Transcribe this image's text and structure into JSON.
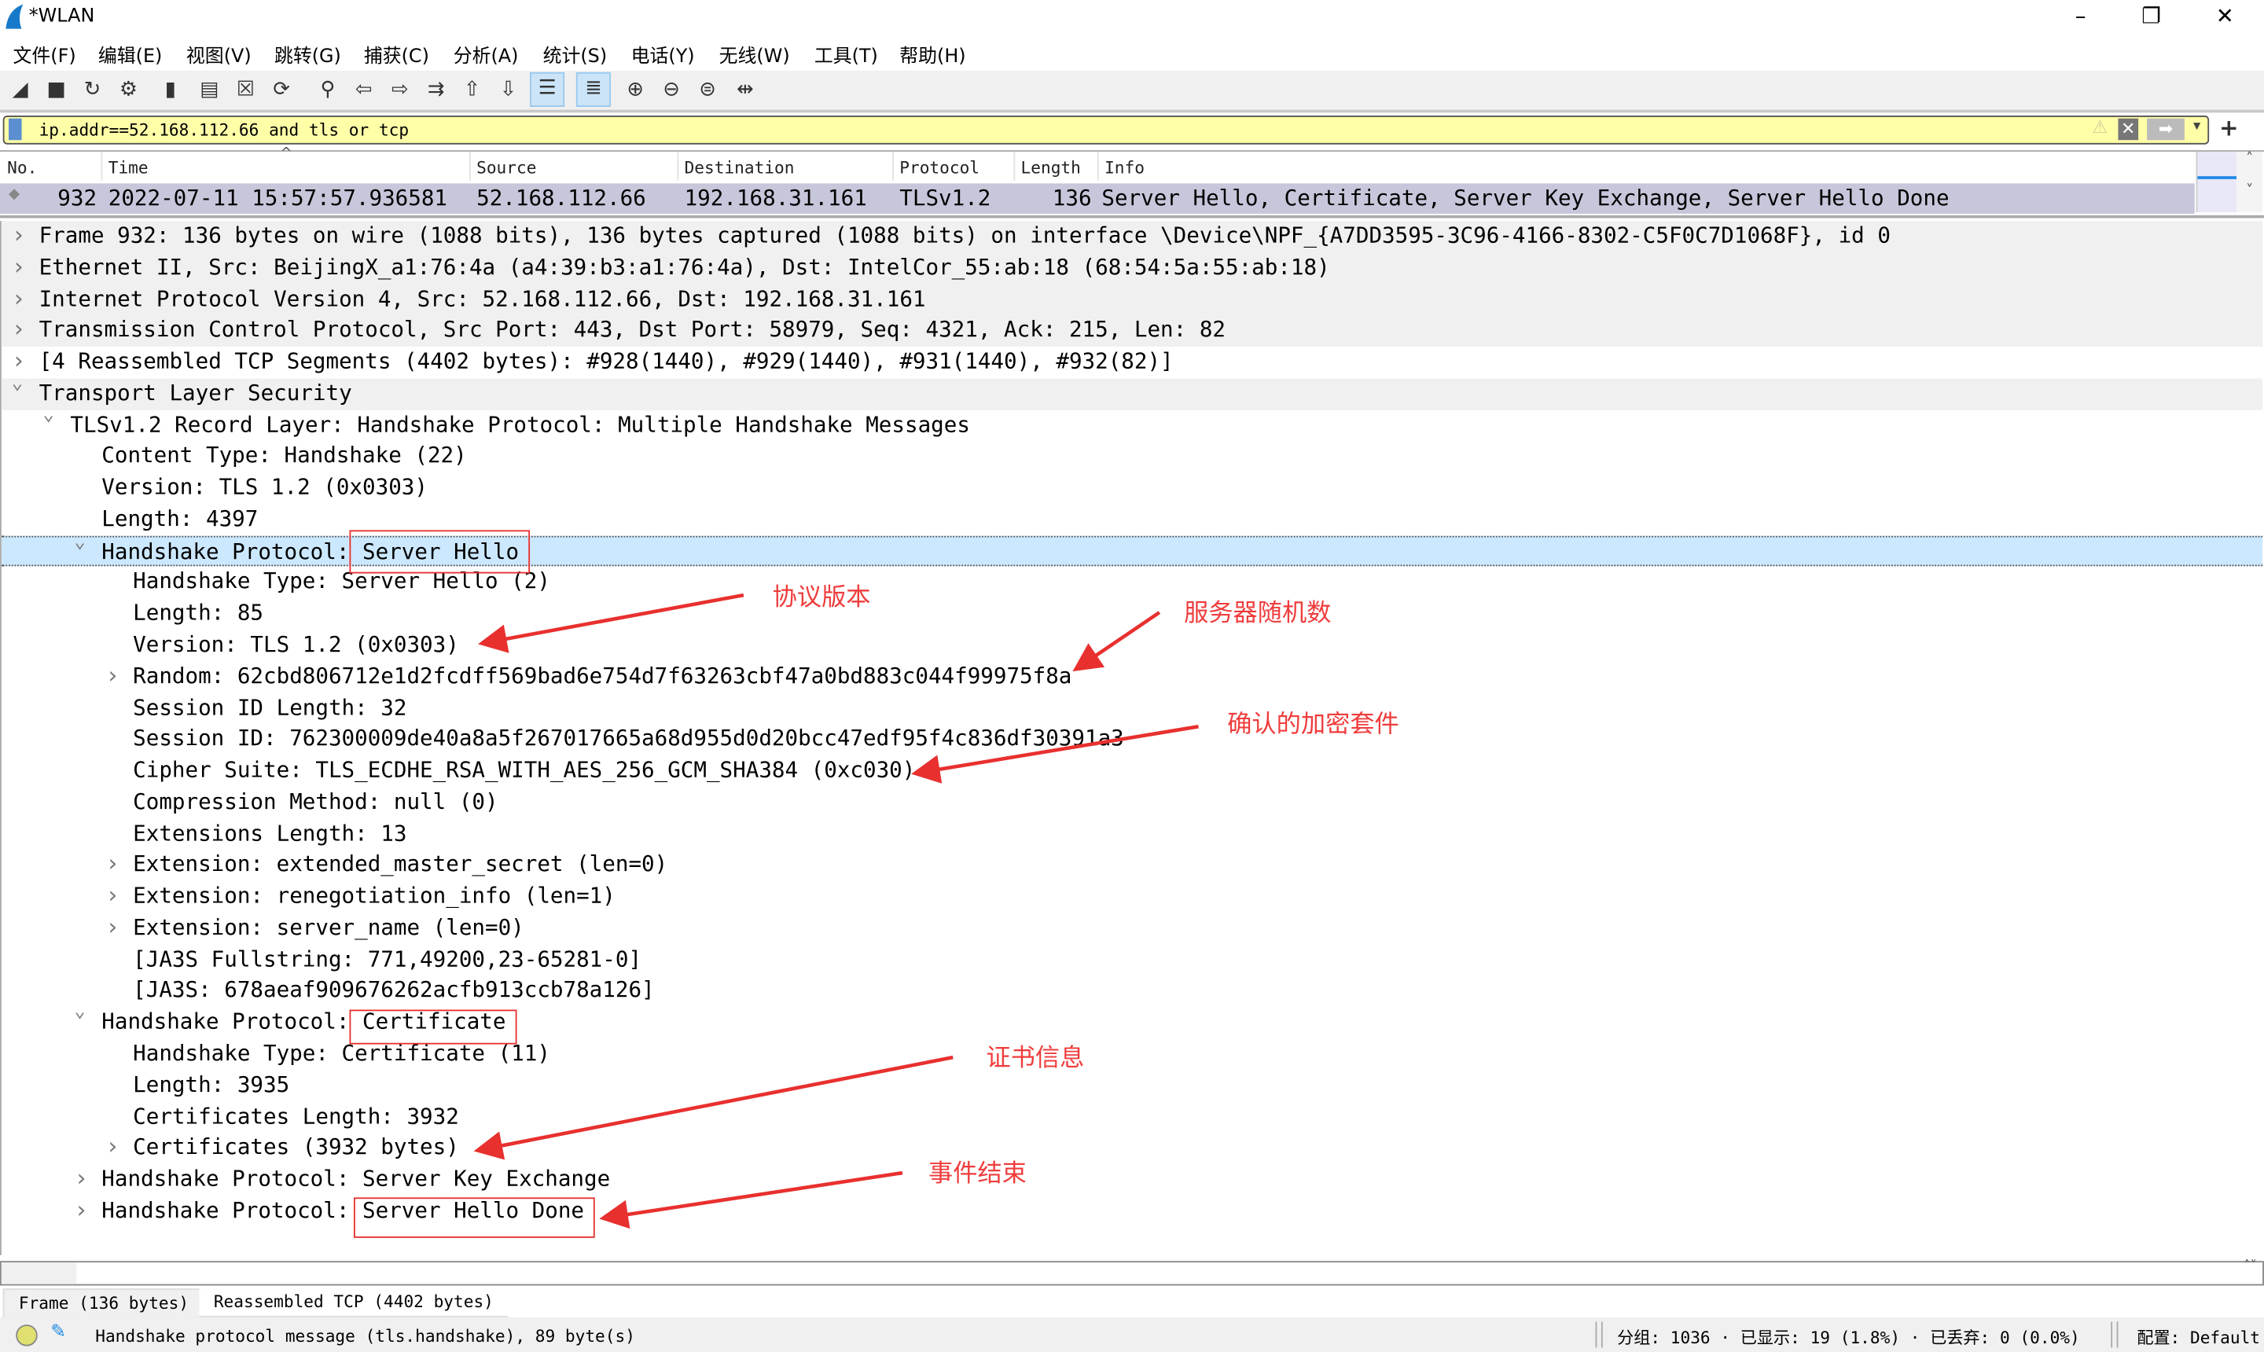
{
  "window": {
    "title": "*WLAN",
    "controls": [
      "minimize",
      "restore",
      "close"
    ]
  },
  "menu": [
    "文件(F)",
    "编辑(E)",
    "视图(V)",
    "跳转(G)",
    "捕获(C)",
    "分析(A)",
    "统计(S)",
    "电话(Y)",
    "无线(W)",
    "工具(T)",
    "帮助(H)"
  ],
  "toolbar": [
    {
      "icon": "shark-fin-start-icon",
      "glyph": "◢"
    },
    {
      "icon": "stop-icon",
      "glyph": "■"
    },
    {
      "icon": "restart-icon",
      "glyph": "↻"
    },
    {
      "icon": "capture-options-icon",
      "glyph": "⚙"
    },
    {
      "icon": "open-folder-icon",
      "glyph": "▮"
    },
    {
      "icon": "save-file-icon",
      "glyph": "▤"
    },
    {
      "icon": "close-file-icon",
      "glyph": "☒"
    },
    {
      "icon": "reload-icon",
      "glyph": "⟳"
    },
    {
      "icon": "find-packet-icon",
      "glyph": "⚲"
    },
    {
      "icon": "go-back-icon",
      "glyph": "⇦"
    },
    {
      "icon": "go-forward-icon",
      "glyph": "⇨"
    },
    {
      "icon": "go-to-packet-icon",
      "glyph": "⇉"
    },
    {
      "icon": "first-packet-icon",
      "glyph": "⇧"
    },
    {
      "icon": "last-packet-icon",
      "glyph": "⇩"
    },
    {
      "icon": "autoscroll-icon",
      "glyph": "☰",
      "active": true
    },
    {
      "icon": "colorize-icon",
      "glyph": "≣",
      "active": true
    },
    {
      "icon": "zoom-in-icon",
      "glyph": "⊕"
    },
    {
      "icon": "zoom-out-icon",
      "glyph": "⊖"
    },
    {
      "icon": "normal-size-icon",
      "glyph": "⊜"
    },
    {
      "icon": "resize-columns-icon",
      "glyph": "⇹"
    }
  ],
  "filter": {
    "value": "ip.addr==52.168.112.66 and tls or tcp",
    "add_label": "+"
  },
  "packet_list": {
    "columns": [
      "No.",
      "Time",
      "Source",
      "Destination",
      "Protocol",
      "Length",
      "Info"
    ],
    "rows": [
      {
        "no": "932",
        "time": "2022-07-11 15:57:57.936581",
        "source": "52.168.112.66",
        "destination": "192.168.31.161",
        "protocol": "TLSv1.2",
        "length": "136",
        "info": "Server Hello, Certificate, Server Key Exchange, Server Hello Done"
      }
    ]
  },
  "tree": [
    {
      "text": "Frame 932: 136 bytes on wire (1088 bits), 136 bytes captured (1088 bits) on interface \\Device\\NPF_{A7DD3595-3C96-4166-8302-C5F0C7D1068F}, id 0",
      "level": 0,
      "state": "collapsed",
      "shade": true
    },
    {
      "text": "Ethernet II, Src: BeijingX_a1:76:4a (a4:39:b3:a1:76:4a), Dst: IntelCor_55:ab:18 (68:54:5a:55:ab:18)",
      "level": 0,
      "state": "collapsed",
      "shade": true
    },
    {
      "text": "Internet Protocol Version 4, Src: 52.168.112.66, Dst: 192.168.31.161",
      "level": 0,
      "state": "collapsed",
      "shade": true
    },
    {
      "text": "Transmission Control Protocol, Src Port: 443, Dst Port: 58979, Seq: 4321, Ack: 215, Len: 82",
      "level": 0,
      "state": "collapsed",
      "shade": true
    },
    {
      "text": "[4 Reassembled TCP Segments (4402 bytes): #928(1440), #929(1440), #931(1440), #932(82)]",
      "level": 0,
      "state": "collapsed"
    },
    {
      "text": "Transport Layer Security",
      "level": 0,
      "state": "expanded",
      "shade": true
    },
    {
      "text": "TLSv1.2 Record Layer: Handshake Protocol: Multiple Handshake Messages",
      "level": 1,
      "state": "expanded"
    },
    {
      "text": "Content Type: Handshake (22)",
      "level": 2
    },
    {
      "text": "Version: TLS 1.2 (0x0303)",
      "level": 2
    },
    {
      "text": "Length: 4397",
      "level": 2
    },
    {
      "text": "Handshake Protocol: Server Hello",
      "level": 2,
      "state": "expanded",
      "selected": true
    },
    {
      "text": "Handshake Type: Server Hello (2)",
      "level": 3
    },
    {
      "text": "Length: 85",
      "level": 3
    },
    {
      "text": "Version: TLS 1.2 (0x0303)",
      "level": 3
    },
    {
      "text": "Random: 62cbd806712e1d2fcdff569bad6e754d7f63263cbf47a0bd883c044f99975f8a",
      "level": 3,
      "state": "collapsed"
    },
    {
      "text": "Session ID Length: 32",
      "level": 3
    },
    {
      "text": "Session ID: 762300009de40a8a5f267017665a68d955d0d20bcc47edf95f4c836df30391a3",
      "level": 3
    },
    {
      "text": "Cipher Suite: TLS_ECDHE_RSA_WITH_AES_256_GCM_SHA384 (0xc030)",
      "level": 3
    },
    {
      "text": "Compression Method: null (0)",
      "level": 3
    },
    {
      "text": "Extensions Length: 13",
      "level": 3
    },
    {
      "text": "Extension: extended_master_secret (len=0)",
      "level": 3,
      "state": "collapsed"
    },
    {
      "text": "Extension: renegotiation_info (len=1)",
      "level": 3,
      "state": "collapsed"
    },
    {
      "text": "Extension: server_name (len=0)",
      "level": 3,
      "state": "collapsed"
    },
    {
      "text": "[JA3S Fullstring: 771,49200,23-65281-0]",
      "level": 3
    },
    {
      "text": "[JA3S: 678aeaf909676262acfb913ccb78a126]",
      "level": 3
    },
    {
      "text": "Handshake Protocol: Certificate",
      "level": 2,
      "state": "expanded"
    },
    {
      "text": "Handshake Type: Certificate (11)",
      "level": 3
    },
    {
      "text": "Length: 3935",
      "level": 3
    },
    {
      "text": "Certificates Length: 3932",
      "level": 3
    },
    {
      "text": "Certificates (3932 bytes)",
      "level": 3,
      "state": "collapsed"
    },
    {
      "text": "Handshake Protocol: Server Key Exchange",
      "level": 2,
      "state": "collapsed"
    },
    {
      "text": "Handshake Protocol: Server Hello Done",
      "level": 2,
      "state": "collapsed"
    }
  ],
  "annotations": {
    "color": "#e8302f",
    "labels": [
      "协议版本",
      "服务器随机数",
      "确认的加密套件",
      "证书信息",
      "事件结束"
    ]
  },
  "bottom_tabs": [
    "Frame (136 bytes)",
    "Reassembled TCP (4402 bytes)"
  ],
  "status": {
    "message": "Handshake protocol message (tls.handshake), 89 byte(s)",
    "stats": "分组: 1036 · 已显示: 19 (1.8%) · 已丢弃: 0 (0.0%)",
    "profile": "配置: Default"
  }
}
